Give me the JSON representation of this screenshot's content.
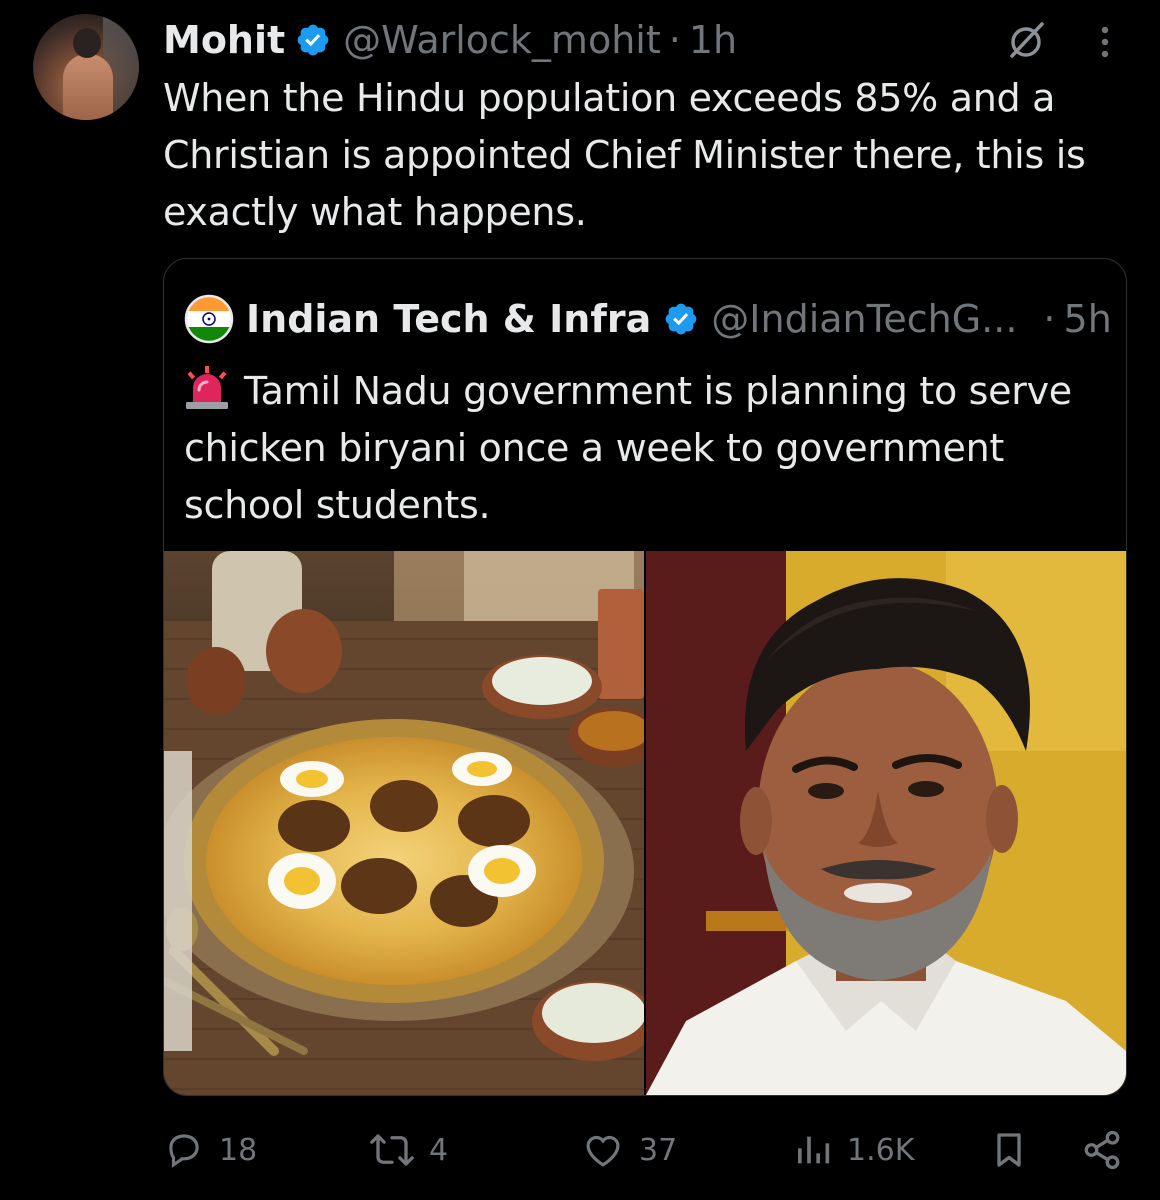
{
  "tweet": {
    "author_name": "Mohit",
    "author_handle": "@Warlock_mohit",
    "separator": "·",
    "time": "1h",
    "text": "When the Hindu population exceeds 85% and a Christian is appointed Chief Minister there, this is exactly what happens."
  },
  "quote": {
    "author_name": "Indian Tech & Infra",
    "author_handle": "@IndianTechG...",
    "separator": "·",
    "time": "5h",
    "text": "Tamil Nadu government is planning to serve chicken biryani once a week to government school students."
  },
  "actions": {
    "replies": "18",
    "reposts": "4",
    "likes": "37",
    "views": "1.6K"
  },
  "colors": {
    "background": "#000000",
    "text": "#e7e9ea",
    "secondary": "#71767b",
    "verified": "#1d9bf0",
    "border": "#2f3336"
  },
  "icons": [
    "verified-badge-icon",
    "grok-icon",
    "more-icon",
    "india-flag-icon",
    "siren-icon",
    "reply-icon",
    "repost-icon",
    "like-icon",
    "views-icon",
    "bookmark-icon",
    "share-icon"
  ]
}
